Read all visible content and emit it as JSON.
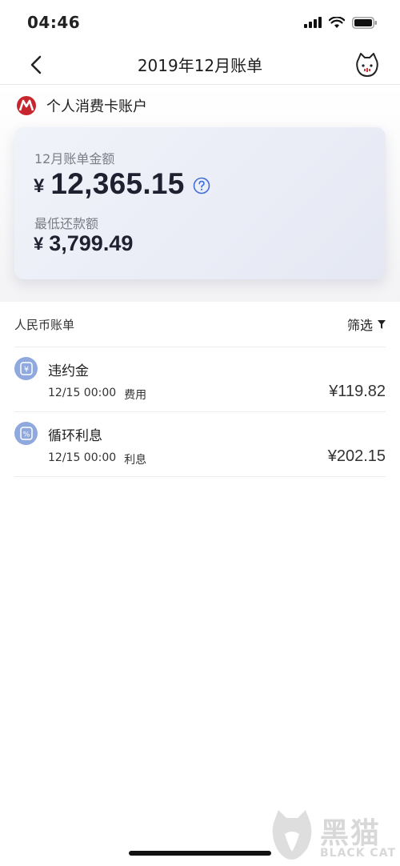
{
  "status_bar": {
    "time": "04:46"
  },
  "nav": {
    "title": "2019年12月账单"
  },
  "account": {
    "name": "个人消费卡账户"
  },
  "bill_card": {
    "bill_label": "12月账单金额",
    "currency": "¥",
    "bill_amount": "12,365.15",
    "min_label": "最低还款额",
    "min_amount": "3,799.49"
  },
  "list": {
    "header_title": "人民币账单",
    "filter_label": "筛选",
    "items": [
      {
        "icon": "yen-icon",
        "icon_glyph": "¥",
        "title": "违约金",
        "date": "12/15 00:00",
        "category": "费用",
        "amount": "¥119.82"
      },
      {
        "icon": "percent-icon",
        "icon_glyph": "%",
        "title": "循环利息",
        "date": "12/15 00:00",
        "category": "利息",
        "amount": "¥202.15"
      }
    ]
  },
  "watermark": {
    "cn": "黑猫",
    "en": "BLACK CAT"
  },
  "colors": {
    "accent": "#3f6fd8",
    "icon_bg": "#8fa8de",
    "brand": "#c8262e"
  }
}
